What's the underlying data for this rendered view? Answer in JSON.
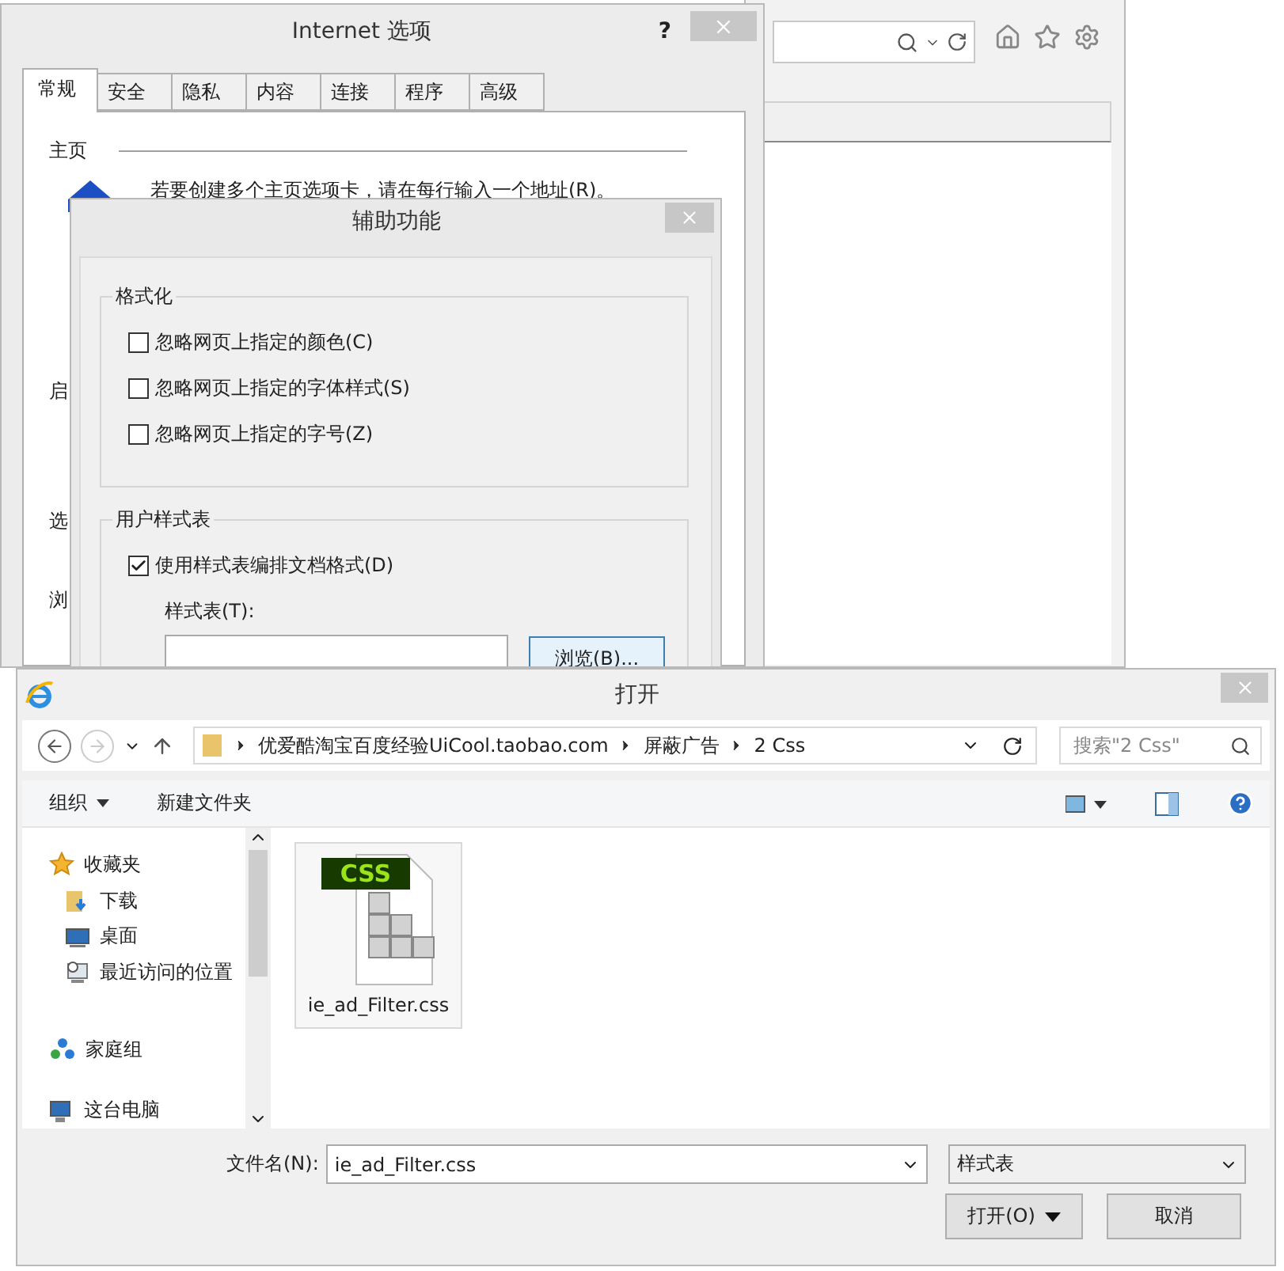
{
  "internet_options": {
    "title": "Internet 选项",
    "help": "?",
    "tabs": [
      {
        "label": "常规",
        "selected": true
      },
      {
        "label": "安全",
        "selected": false
      },
      {
        "label": "隐私",
        "selected": false
      },
      {
        "label": "内容",
        "selected": false
      },
      {
        "label": "连接",
        "selected": false
      },
      {
        "label": "程序",
        "selected": false
      },
      {
        "label": "高级",
        "selected": false
      }
    ],
    "home_page": {
      "heading": "主页",
      "instruction": "若要创建多个主页选项卡，请在每行输入一个地址(R)。"
    },
    "partial_labels": [
      "启",
      "选",
      "浏"
    ]
  },
  "accessibility": {
    "title": "辅助功能",
    "formatting": {
      "heading": "格式化",
      "options": [
        {
          "label": "忽略网页上指定的颜色(C)",
          "checked": false
        },
        {
          "label": "忽略网页上指定的字体样式(S)",
          "checked": false
        },
        {
          "label": "忽略网页上指定的字号(Z)",
          "checked": false
        }
      ]
    },
    "user_style_sheet": {
      "heading": "用户样式表",
      "option": {
        "label": "使用样式表编排文档格式(D)",
        "checked": true
      },
      "field_label": "样式表(T):",
      "browse_button": "浏览(B)..."
    }
  },
  "open_dialog": {
    "title": "打开",
    "path": [
      "优爱酷淘宝百度经验UiCool.taobao.com",
      "屏蔽广告",
      "2 Css"
    ],
    "search_placeholder": "搜索\"2 Css\"",
    "toolbar": {
      "organize": "组织",
      "new_folder": "新建文件夹"
    },
    "nav_items": [
      {
        "label": "收藏夹",
        "kind": "star",
        "children": [
          {
            "label": "下载",
            "kind": "download"
          },
          {
            "label": "桌面",
            "kind": "desktop"
          },
          {
            "label": "最近访问的位置",
            "kind": "recent"
          }
        ]
      },
      {
        "label": "家庭组",
        "kind": "homegroup"
      },
      {
        "label": "这台电脑",
        "kind": "computer"
      }
    ],
    "files": [
      {
        "name": "ie_ad_Filter.css",
        "badge": "CSS"
      }
    ],
    "filename_label": "文件名(N):",
    "filename_value": "ie_ad_Filter.css",
    "filetype": "样式表",
    "open_button": "打开(O)",
    "cancel_button": "取消"
  }
}
